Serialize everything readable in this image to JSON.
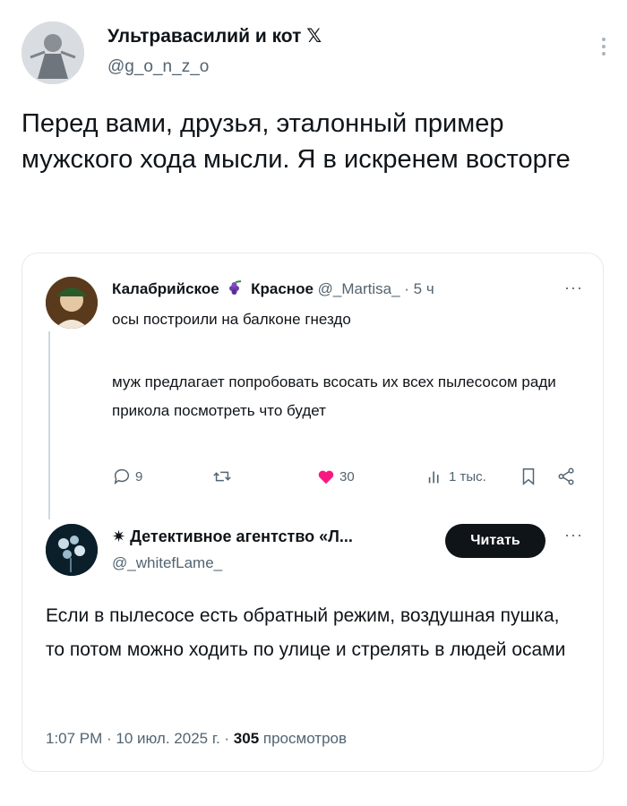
{
  "outer": {
    "name": "Ультравасилий и кот 𝕏",
    "handle": "@g_o_n_z_o",
    "text": "Перед вами, друзья, эталонный пример мужского хода мысли. Я в искренем восторге"
  },
  "quoted": {
    "name1": "Калабрийское",
    "name2": "Красное",
    "handle": "@_Martisa_",
    "time": "· 5 ч",
    "more": "···",
    "line1": "осы построили на балконе гнездо",
    "body": "муж предлагает попробовать всосать их всех пылесосом ради прикола посмотреть что будет",
    "actions": {
      "replies": "9",
      "likes": "30",
      "views": "1 тыс."
    }
  },
  "reply": {
    "name": "✷ Детективное агентство «Л...",
    "handle": "@_whitefLame_",
    "read_label": "Читать",
    "more": "···",
    "body": "Если в пылесосе есть обратный режим, воздушная пушка, то потом можно ходить по улице и стрелять в людей осами",
    "footer_time": "1:07 PM · 10 июл. 2025 г. · ",
    "footer_views_count": "305",
    "footer_views_label": " просмотров"
  },
  "colors": {
    "text": "#0f1419",
    "secondary": "#536471",
    "like": "#f91880",
    "border": "#e6e9ec"
  }
}
